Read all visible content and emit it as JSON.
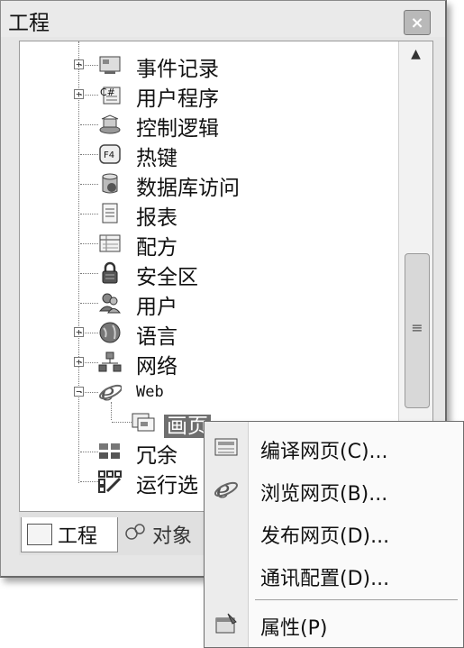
{
  "panel": {
    "title": "工程",
    "close_icon": "close-icon"
  },
  "tree": {
    "items": [
      {
        "label": "事件记录",
        "icon": "event-log-icon",
        "expandable": true
      },
      {
        "label": "用户程序",
        "icon": "csharp-script-icon",
        "expandable": true
      },
      {
        "label": "控制逻辑",
        "icon": "control-logic-icon",
        "expandable": false
      },
      {
        "label": "热键",
        "icon": "hotkey-icon",
        "expandable": false
      },
      {
        "label": "数据库访问",
        "icon": "database-icon",
        "expandable": false
      },
      {
        "label": "报表",
        "icon": "report-icon",
        "expandable": false
      },
      {
        "label": "配方",
        "icon": "recipe-icon",
        "expandable": false
      },
      {
        "label": "安全区",
        "icon": "lock-icon",
        "expandable": false
      },
      {
        "label": "用户",
        "icon": "users-icon",
        "expandable": false
      },
      {
        "label": "语言",
        "icon": "globe-icon",
        "expandable": true
      },
      {
        "label": "网络",
        "icon": "network-icon",
        "expandable": true
      },
      {
        "label": "Web",
        "icon": "ie-icon",
        "expandable": true,
        "expanded": true
      },
      {
        "label": "画页",
        "icon": "web-page-icon",
        "child": true,
        "selected": true
      },
      {
        "label": "冗余",
        "icon": "redundancy-icon",
        "expandable": false
      },
      {
        "label": "运行选",
        "icon": "run-options-icon",
        "expandable": false
      }
    ],
    "expand_glyph": "+",
    "collapse_glyph": "−"
  },
  "tabs": [
    {
      "label": "工程",
      "icon": "project-tab-icon"
    },
    {
      "label": "对象",
      "icon": "objects-tab-icon"
    }
  ],
  "context_menu": {
    "items": [
      {
        "label": "编译网页(C)...",
        "icon": "compile-icon"
      },
      {
        "label": "浏览网页(B)...",
        "icon": "ie-icon"
      },
      {
        "label": "发布网页(D)...",
        "icon": ""
      },
      {
        "label": "通讯配置(D)...",
        "icon": ""
      },
      {
        "label": "属性(P)",
        "icon": "properties-icon"
      }
    ]
  }
}
